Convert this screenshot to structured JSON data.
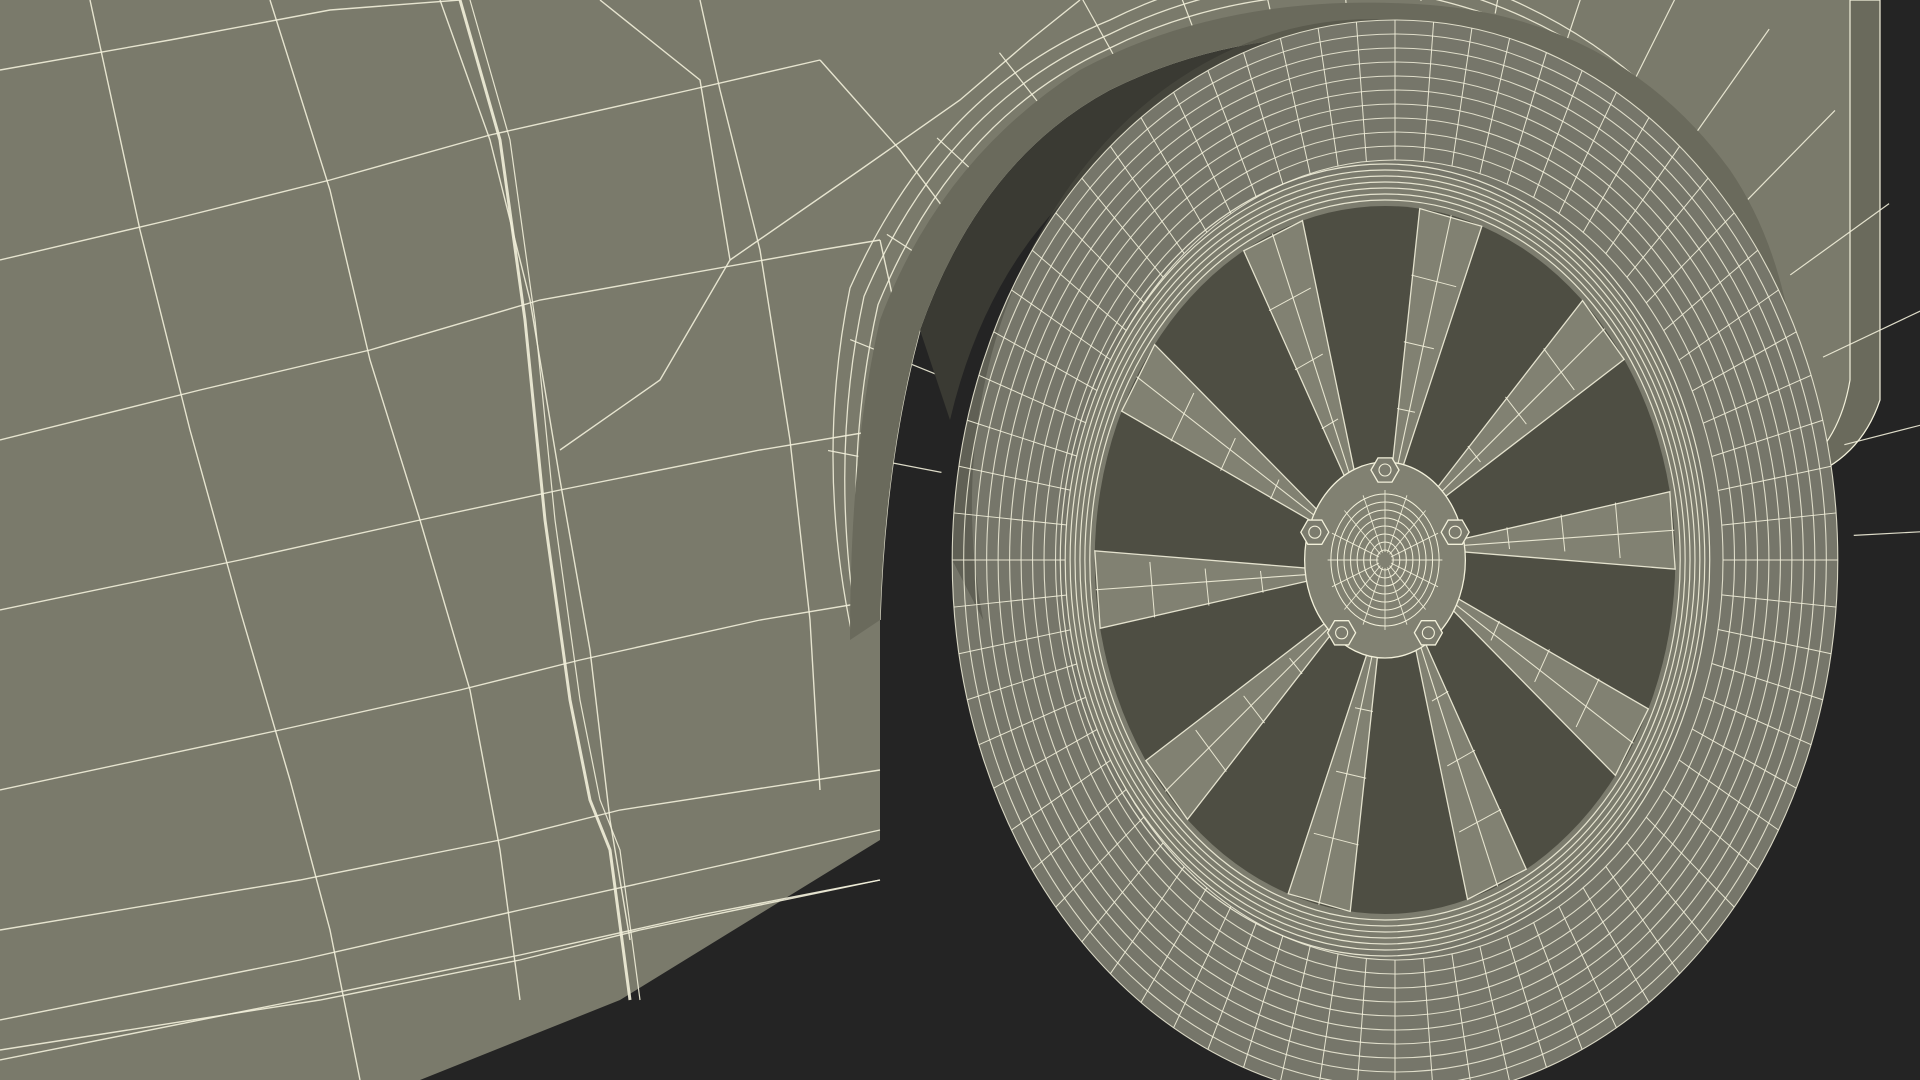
{
  "scene": {
    "subject": "car-front-wheel-wireframe",
    "colors": {
      "background": "#242424",
      "body_fill": "#7a7a6b",
      "body_dark": "#6a6a5c",
      "shadow": "#4e4e43",
      "deep_shadow": "#3a3a33",
      "wire": "#f2f0da",
      "tire_fill": "#76766a",
      "rim_fill": "#7c7c6e",
      "spoke_fill": "#818172"
    },
    "wheel": {
      "spoke_count": 10,
      "lug_nut_count": 5
    }
  }
}
